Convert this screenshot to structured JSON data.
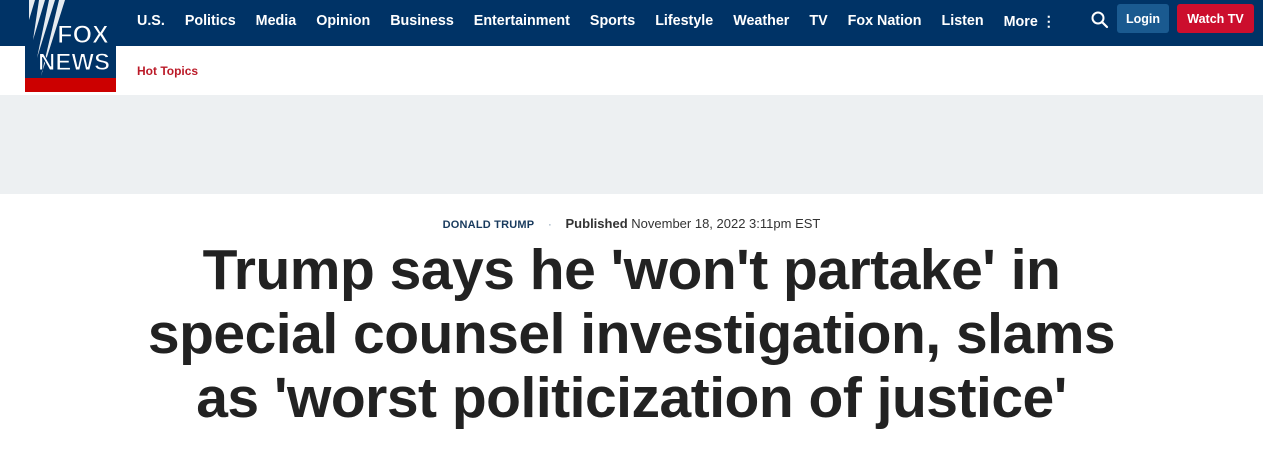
{
  "brand": {
    "logo_line1": "FOX",
    "logo_line2": "NEWS",
    "colors": {
      "navy": "#003366",
      "red": "#cc0000",
      "watch_red": "#cc0e2d",
      "login_blue": "#1a5a90",
      "hot_topics_red": "#bb1a28"
    }
  },
  "nav": {
    "items": [
      "U.S.",
      "Politics",
      "Media",
      "Opinion",
      "Business",
      "Entertainment",
      "Sports",
      "Lifestyle",
      "Weather",
      "TV",
      "Fox Nation",
      "Listen"
    ],
    "more_label": "More",
    "more_icon": "vertical-dots-icon"
  },
  "header_actions": {
    "search_icon": "search-icon",
    "login_label": "Login",
    "watch_label": "Watch TV"
  },
  "subnav": {
    "hot_topics": "Hot Topics"
  },
  "article": {
    "eyebrow": "DONALD TRUMP",
    "separator": "·",
    "published_label": "Published",
    "published_date": "November 18, 2022 3:11pm EST",
    "headline": "Trump says he 'won't partake' in special counsel investigation, slams as 'worst politicization of justice'"
  }
}
